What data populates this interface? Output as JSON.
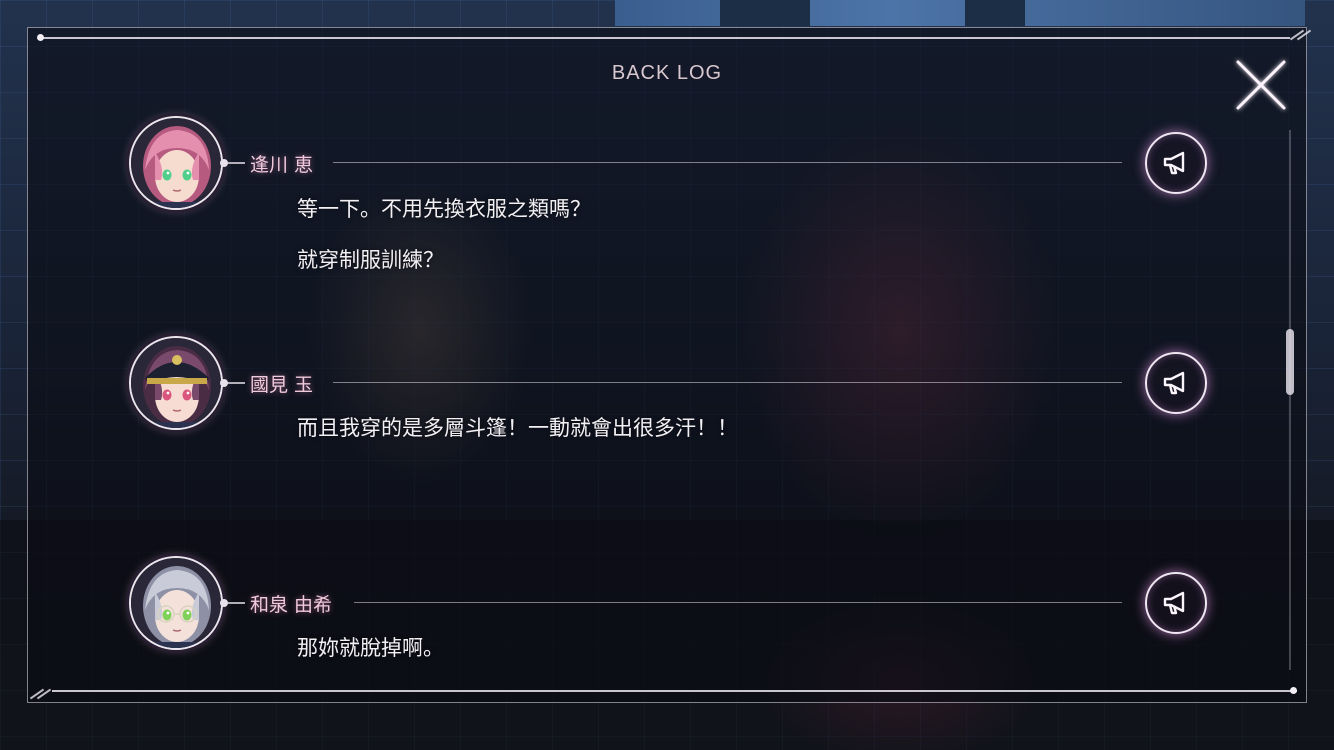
{
  "backlog": {
    "title": "BACK LOG",
    "close_icon": "close-x-icon",
    "entries": [
      {
        "speaker": "逢川 恵",
        "lines": [
          "等一下。不用先換衣服之類嗎？",
          "就穿制服訓練？"
        ],
        "avatar": {
          "hair": "#e58fae",
          "hair_dark": "#b65a80",
          "eyes": "#4fcf8a",
          "skin": "#f6dccf",
          "accessory": "none"
        },
        "voice_icon": "megaphone-icon"
      },
      {
        "speaker": "國見 玉",
        "lines": [
          "而且我穿的是多層斗篷！一動就會出很多汗！！"
        ],
        "avatar": {
          "hair": "#7a4a6c",
          "hair_dark": "#4a2c44",
          "eyes": "#d9557e",
          "skin": "#f6dcd2",
          "accessory": "military-cap"
        },
        "voice_icon": "megaphone-icon"
      },
      {
        "speaker": "和泉 由希",
        "lines": [
          "那妳就脫掉啊。"
        ],
        "avatar": {
          "hair": "#c9cbd8",
          "hair_dark": "#8e90a6",
          "eyes": "#7fd15a",
          "skin": "#f4e2da",
          "accessory": "glasses"
        },
        "voice_icon": "megaphone-icon"
      }
    ]
  },
  "scroll": {
    "position_fraction": 0.42
  },
  "colors": {
    "name": "#f0c9dc",
    "text": "#f3f0f4",
    "title": "#d9c8cf",
    "glow": "#e696e6"
  }
}
